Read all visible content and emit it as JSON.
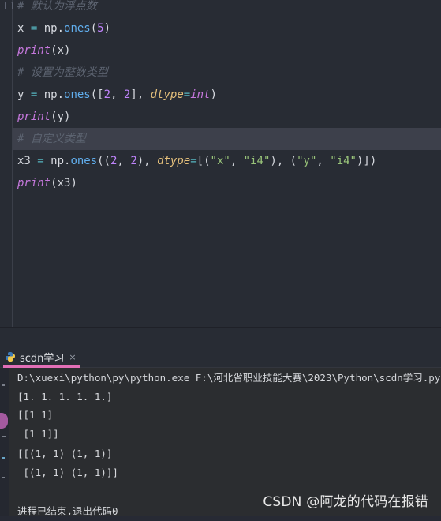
{
  "editor": {
    "lines": [
      {
        "type": "comment",
        "text": "# 默认为浮点数"
      },
      {
        "type": "code",
        "tokens": [
          [
            "mod",
            "x "
          ],
          [
            "op",
            "="
          ],
          [
            "mod",
            " np."
          ],
          [
            "fn",
            "ones"
          ],
          [
            "mod",
            "("
          ],
          [
            "num",
            "5"
          ],
          [
            "mod",
            ")"
          ]
        ]
      },
      {
        "type": "code",
        "tokens": [
          [
            "kw",
            "print"
          ],
          [
            "mod",
            "(x)"
          ]
        ]
      },
      {
        "type": "comment",
        "text": "# 设置为整数类型"
      },
      {
        "type": "code",
        "tokens": [
          [
            "mod",
            "y "
          ],
          [
            "op",
            "="
          ],
          [
            "mod",
            " np."
          ],
          [
            "fn",
            "ones"
          ],
          [
            "mod",
            "(["
          ],
          [
            "num",
            "2"
          ],
          [
            "mod",
            ", "
          ],
          [
            "num",
            "2"
          ],
          [
            "mod",
            "], "
          ],
          [
            "pm",
            "dtype"
          ],
          [
            "op",
            "="
          ],
          [
            "kw",
            "int"
          ],
          [
            "mod",
            ")"
          ]
        ]
      },
      {
        "type": "code",
        "tokens": [
          [
            "kw",
            "print"
          ],
          [
            "mod",
            "(y)"
          ]
        ]
      },
      {
        "type": "comment",
        "text": "# 自定义类型"
      },
      {
        "type": "code",
        "tokens": [
          [
            "mod",
            "x3 "
          ],
          [
            "op",
            "="
          ],
          [
            "mod",
            " np."
          ],
          [
            "fn",
            "ones"
          ],
          [
            "mod",
            "(("
          ],
          [
            "num",
            "2"
          ],
          [
            "mod",
            ", "
          ],
          [
            "num",
            "2"
          ],
          [
            "mod",
            "), "
          ],
          [
            "pm",
            "dtype"
          ],
          [
            "op",
            "="
          ],
          [
            "mod",
            "[("
          ],
          [
            "str",
            "\"x\""
          ],
          [
            "mod",
            ", "
          ],
          [
            "str",
            "\"i4\""
          ],
          [
            "mod",
            "), ("
          ],
          [
            "str",
            "\"y\""
          ],
          [
            "mod",
            ", "
          ],
          [
            "str",
            "\"i4\""
          ],
          [
            "mod",
            ")])"
          ]
        ]
      },
      {
        "type": "code",
        "tokens": [
          [
            "kw",
            "print"
          ],
          [
            "mod",
            "(x3)"
          ]
        ]
      }
    ]
  },
  "run_panel": {
    "tab_label": "scdn学习",
    "tab_close": "×",
    "output": [
      "D:\\xuexi\\python\\py\\python.exe F:\\河北省职业技能大赛\\2023\\Python\\scdn学习.py",
      "[1. 1. 1. 1. 1.]",
      "[[1 1]",
      " [1 1]]",
      "[[(1, 1) (1, 1)]",
      " [(1, 1) (1, 1)]]",
      "",
      "进程已结束,退出代码0"
    ]
  },
  "watermark": "CSDN @阿龙的代码在报错",
  "colors": {
    "editor_bg": "#282c34",
    "highlight_line": "#3d404b",
    "tab_accent": "#e26fb7"
  }
}
